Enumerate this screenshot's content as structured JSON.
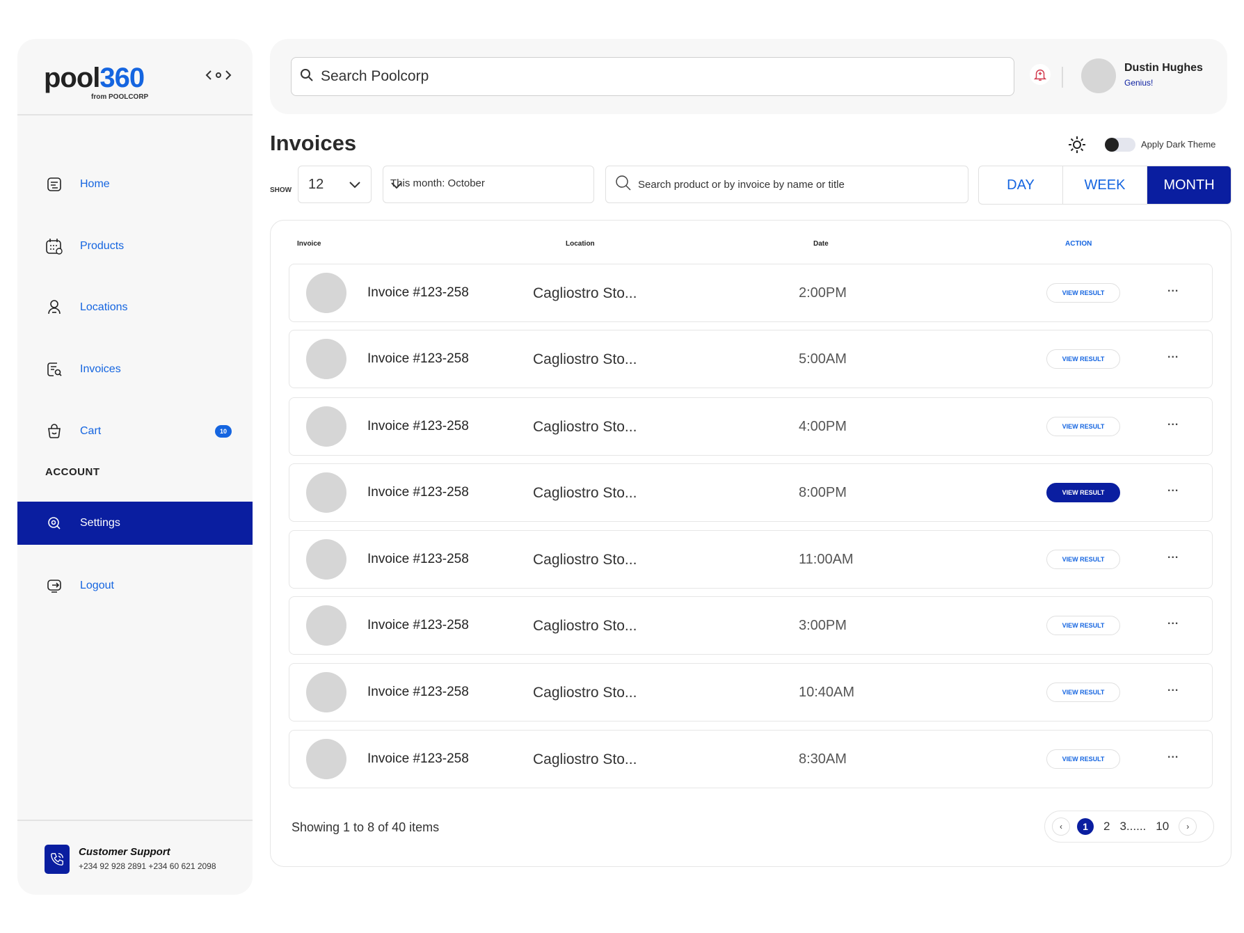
{
  "brand": {
    "logo_a": "pool",
    "logo_b": "360",
    "logo_sub": "from POOLCORP"
  },
  "sidebar": {
    "items": [
      {
        "label": "Home",
        "icon": "home-doc-icon"
      },
      {
        "label": "Products",
        "icon": "calendar-grid-icon"
      },
      {
        "label": "Locations",
        "icon": "person-pin-icon"
      },
      {
        "label": "Invoices",
        "icon": "invoice-search-icon"
      },
      {
        "label": "Cart",
        "icon": "cart-bag-icon",
        "badge": "10"
      }
    ],
    "account_label": "ACCOUNT",
    "account_items": [
      {
        "label": "Settings",
        "icon": "settings-icon",
        "active": true
      },
      {
        "label": "Logout",
        "icon": "logout-icon"
      }
    ],
    "support": {
      "title": "Customer Support",
      "phones": "+234 92 928 2891  +234 60 621 2098"
    }
  },
  "header": {
    "search_placeholder": "Search Poolcorp",
    "user_name": "Dustin Hughes",
    "user_role": "Genius!"
  },
  "page": {
    "title": "Invoices",
    "dark_theme_label": "Apply Dark Theme",
    "dark_theme_on": false
  },
  "filters": {
    "show_label": "SHOW",
    "show_value": "12",
    "month_value": "This month: October",
    "search_placeholder": "Search product or by invoice by name or title",
    "segments": [
      {
        "label": "DAY",
        "active": false
      },
      {
        "label": "WEEK",
        "active": false
      },
      {
        "label": "MONTH",
        "active": true
      }
    ]
  },
  "table": {
    "columns": [
      "Invoice",
      "Location",
      "Date",
      "ACTION"
    ],
    "action_label": "VIEW RESULT",
    "more_label": "...",
    "rows": [
      {
        "invoice": "Invoice #123-258",
        "location": "Cagliostro Sto...",
        "time": "2:00PM",
        "highlight": false
      },
      {
        "invoice": "Invoice #123-258",
        "location": "Cagliostro Sto...",
        "time": "5:00AM",
        "highlight": false
      },
      {
        "invoice": "Invoice #123-258",
        "location": "Cagliostro Sto...",
        "time": "4:00PM",
        "highlight": false
      },
      {
        "invoice": "Invoice #123-258",
        "location": "Cagliostro Sto...",
        "time": "8:00PM",
        "highlight": true
      },
      {
        "invoice": "Invoice #123-258",
        "location": "Cagliostro Sto...",
        "time": "11:00AM",
        "highlight": false
      },
      {
        "invoice": "Invoice #123-258",
        "location": "Cagliostro Sto...",
        "time": "3:00PM",
        "highlight": false
      },
      {
        "invoice": "Invoice #123-258",
        "location": "Cagliostro Sto...",
        "time": "10:40AM",
        "highlight": false
      },
      {
        "invoice": "Invoice #123-258",
        "location": "Cagliostro Sto...",
        "time": "8:30AM",
        "highlight": false
      }
    ],
    "footer": "Showing 1 to 8 of 40 items",
    "pagination": {
      "pages": [
        "1",
        "2",
        "3......",
        "10"
      ],
      "current": "1",
      "prev": "‹",
      "next": "›"
    }
  },
  "colors": {
    "accent": "#1565e0",
    "primary": "#0a1ea0",
    "panel": "#f7f7f7"
  }
}
